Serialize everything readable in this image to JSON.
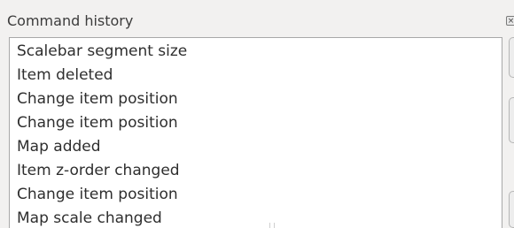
{
  "panel": {
    "title": "Command history",
    "close_icon": "close-icon"
  },
  "history": {
    "items": [
      "Scalebar segment size",
      "Item deleted",
      "Change item position",
      "Change item position",
      "Map added",
      "Item z-order changed",
      "Change item position",
      "Map scale changed"
    ]
  }
}
